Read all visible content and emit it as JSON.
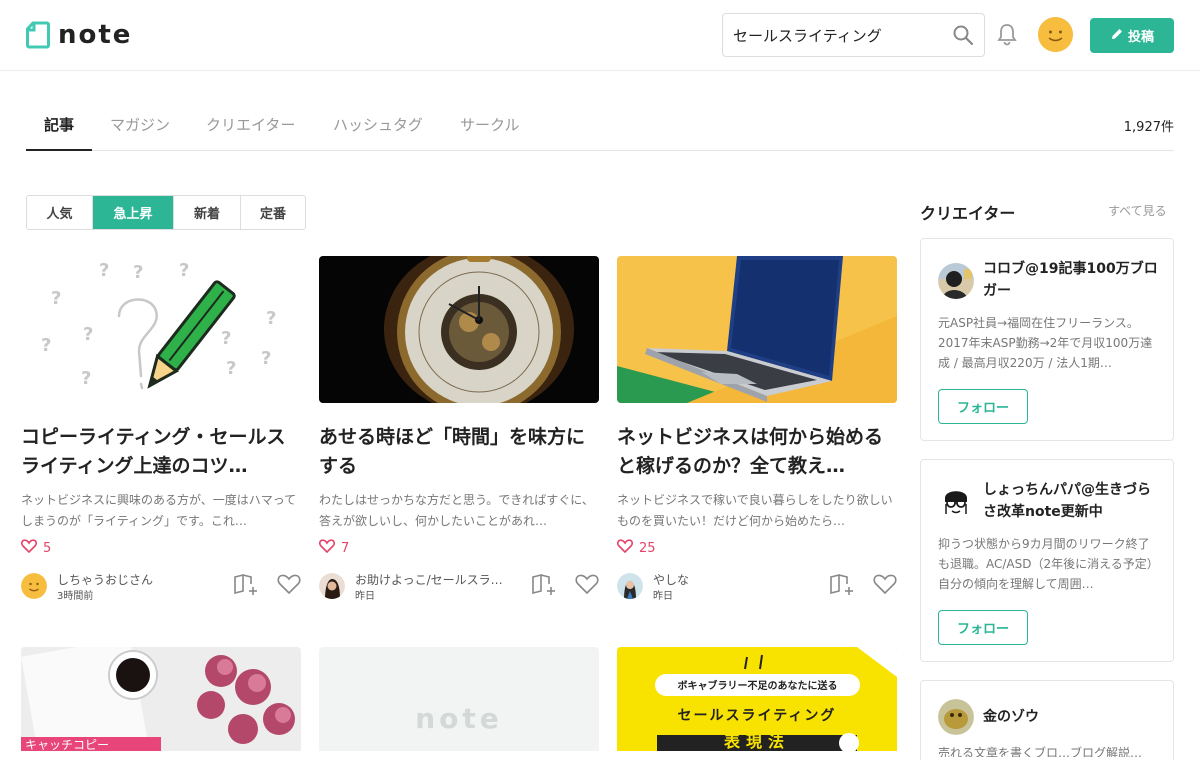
{
  "header": {
    "logo_text": "note",
    "search_value": "セールスライティング",
    "post_label": "投稿",
    "brand_color": "#2cb696"
  },
  "tabs": [
    {
      "label": "記事",
      "active": true
    },
    {
      "label": "マガジン"
    },
    {
      "label": "クリエイター"
    },
    {
      "label": "ハッシュタグ"
    },
    {
      "label": "サークル"
    }
  ],
  "result_count": "1,927件",
  "filters": [
    {
      "label": "人気"
    },
    {
      "label": "急上昇",
      "active": true
    },
    {
      "label": "新着"
    },
    {
      "label": "定番"
    }
  ],
  "cards": [
    {
      "title": "コピーライティング・セールスライティング上達のコツ…",
      "excerpt": "ネットビジネスに興味のある方が、一度はハマってしまうのが「ライティング」です。これ…",
      "likes": "5",
      "author": "しちゃうおじさん",
      "time": "3時間前"
    },
    {
      "title": "あせる時ほど「時間」を味方にする",
      "excerpt": "わたしはせっかちな方だと思う。できればすぐに、答えが欲しいし、何かしたいことがあれ…",
      "likes": "7",
      "author": "お助けよっこ/セールスラ…",
      "time": "昨日"
    },
    {
      "title": "ネットビジネスは何から始めると稼げるのか？全て教え…",
      "excerpt": "ネットビジネスで稼いで良い暮らしをしたり欲しいものを買いたい！だけど何から始めたら…",
      "likes": "25",
      "author": "やしな",
      "time": "昨日"
    }
  ],
  "bottom_cards": {
    "card1_caption": "キャッチコピー",
    "card2_placeholder": "note",
    "card3_banner": "ボキャブラリー不足のあなたに送る",
    "card3_title": "セールスライティング",
    "card3_big": "表現法"
  },
  "sidebar": {
    "title": "クリエイター",
    "see_all": "すべて見る",
    "creators": [
      {
        "name": "コロブ@19記事100万ブロガー",
        "desc": "元ASP社員→福岡在住フリーランス。2017年末ASP勤務→2年で月収100万達成 / 最高月収220万 / 法人1期…",
        "follow": "フォロー"
      },
      {
        "name": "しょっちんパパ@生きづらさ改革note更新中",
        "desc": "抑うつ状態から9カ月間のリワーク終了も退職。AC/ASD（2年後に消える予定）自分の傾向を理解して周囲…",
        "follow": "フォロー"
      },
      {
        "name": "金のゾウ",
        "desc": "売れる文章を書くブロ…ブログ解説…"
      }
    ]
  }
}
